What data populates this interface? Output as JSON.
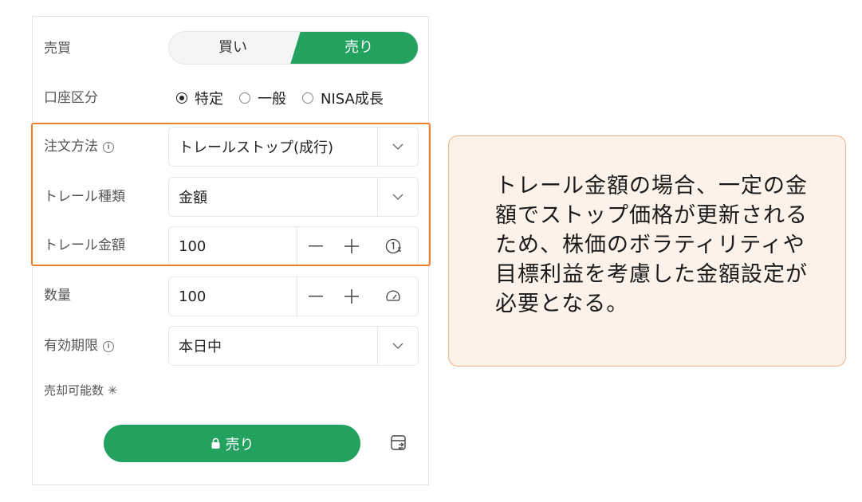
{
  "order": {
    "side_label": "売買",
    "buy_label": "買い",
    "sell_label": "売り",
    "account_label": "口座区分",
    "account_options": [
      "特定",
      "一般",
      "NISA成長"
    ],
    "account_selected": "特定",
    "method_label": "注文方法",
    "method_value": "トレールストップ(成行)",
    "trail_type_label": "トレール種類",
    "trail_type_value": "金額",
    "trail_amount_label": "トレール金額",
    "trail_amount_value": "100",
    "quantity_label": "数量",
    "quantity_value": "100",
    "validity_label": "有効期限",
    "validity_value": "本日中",
    "sell_count_label": "売却可能数 ✳",
    "submit_label": "売り"
  },
  "callout": {
    "text": "トレール金額の場合、一定の金額でストップ価格が更新されるため、株価のボラティリティや目標利益を考慮した金額設定が必要となる。"
  },
  "colors": {
    "accent_green": "#23a15f",
    "highlight_orange": "#ef7f2a",
    "callout_bg": "#fdf2ea",
    "callout_border": "#f0b286"
  },
  "icons": {
    "info": "info-icon",
    "dropdown": "chevron-down-icon",
    "minus": "minus-icon",
    "plus": "plus-icon",
    "price": "price-tool-icon",
    "gauge": "gauge-icon",
    "lock": "lock-icon",
    "sheet": "order-sheet-icon"
  }
}
